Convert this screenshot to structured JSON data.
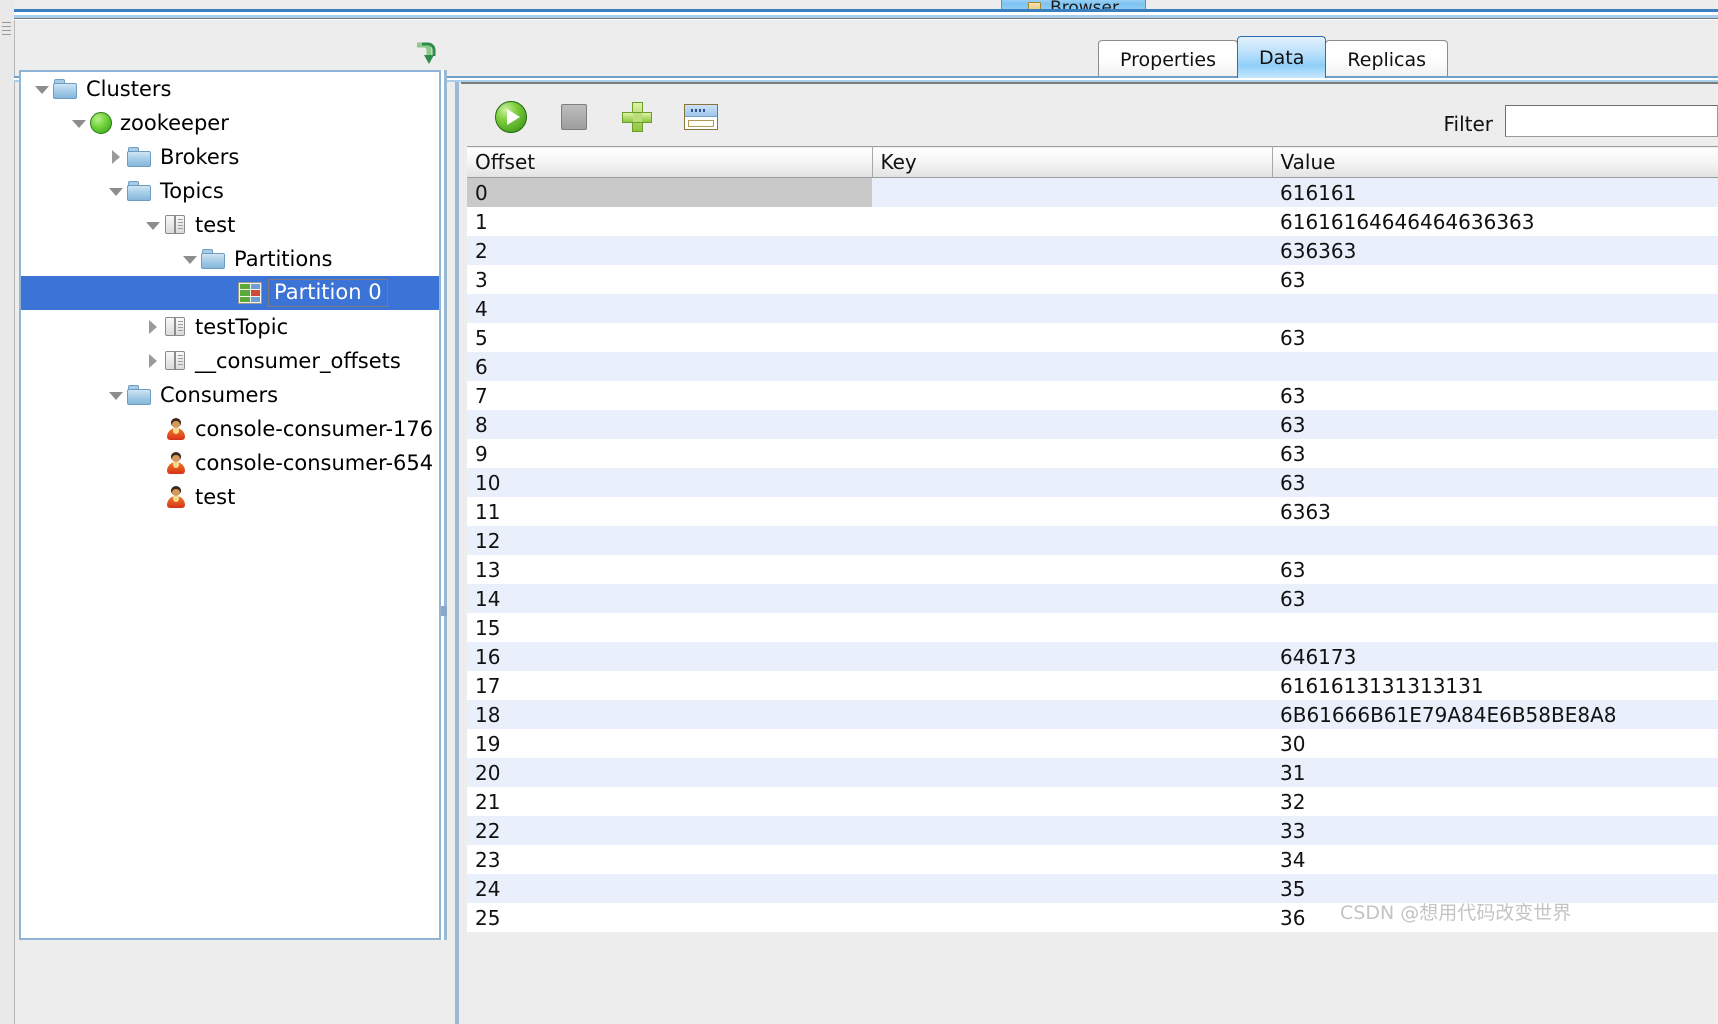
{
  "window": {
    "main_tab": {
      "label": "Browser",
      "icon": "document-icon"
    }
  },
  "panel_tabs": {
    "items": [
      {
        "label": "Properties",
        "active": false
      },
      {
        "label": "Data",
        "active": true
      },
      {
        "label": "Replicas",
        "active": false
      }
    ]
  },
  "tree": {
    "refresh_icon": "refresh-down-arrow-icon",
    "nodes": [
      {
        "label": "Clusters",
        "icon": "folder-icon",
        "twisty": "down",
        "depth": 0,
        "selected": false
      },
      {
        "label": "zookeeper",
        "icon": "green-ball-icon",
        "twisty": "down",
        "depth": 1,
        "selected": false
      },
      {
        "label": "Brokers",
        "icon": "folder-icon",
        "twisty": "right",
        "depth": 2,
        "selected": false
      },
      {
        "label": "Topics",
        "icon": "folder-icon",
        "twisty": "down",
        "depth": 2,
        "selected": false
      },
      {
        "label": "test",
        "icon": "book-icon",
        "twisty": "down",
        "depth": 3,
        "selected": false
      },
      {
        "label": "Partitions",
        "icon": "folder-icon",
        "twisty": "down",
        "depth": 4,
        "selected": false
      },
      {
        "label": "Partition 0",
        "icon": "partition-icon",
        "twisty": "none",
        "depth": 5,
        "selected": true
      },
      {
        "label": "testTopic",
        "icon": "book-icon",
        "twisty": "right",
        "depth": 3,
        "selected": false
      },
      {
        "label": "__consumer_offsets",
        "icon": "book-icon",
        "twisty": "right",
        "depth": 3,
        "selected": false
      },
      {
        "label": "Consumers",
        "icon": "folder-icon",
        "twisty": "down",
        "depth": 2,
        "selected": false
      },
      {
        "label": "console-consumer-176",
        "icon": "user-icon",
        "twisty": "none",
        "depth": 3,
        "selected": false
      },
      {
        "label": "console-consumer-654",
        "icon": "user-icon",
        "twisty": "none",
        "depth": 3,
        "selected": false
      },
      {
        "label": "test",
        "icon": "user-icon",
        "twisty": "none",
        "depth": 3,
        "selected": false
      }
    ]
  },
  "toolbar": {
    "play_icon": "play-icon",
    "stop_icon": "stop-icon",
    "add_icon": "plus-icon",
    "form_icon": "form-window-icon",
    "filter_label": "Filter",
    "filter_value": "",
    "filter_placeholder": ""
  },
  "table": {
    "columns": [
      "Offset",
      "Key",
      "Value"
    ],
    "rows": [
      {
        "offset": "0",
        "key": "",
        "value": "616161"
      },
      {
        "offset": "1",
        "key": "",
        "value": "61616164646464636363"
      },
      {
        "offset": "2",
        "key": "",
        "value": "636363"
      },
      {
        "offset": "3",
        "key": "",
        "value": "63"
      },
      {
        "offset": "4",
        "key": "",
        "value": ""
      },
      {
        "offset": "5",
        "key": "",
        "value": "63"
      },
      {
        "offset": "6",
        "key": "",
        "value": ""
      },
      {
        "offset": "7",
        "key": "",
        "value": "63"
      },
      {
        "offset": "8",
        "key": "",
        "value": "63"
      },
      {
        "offset": "9",
        "key": "",
        "value": "63"
      },
      {
        "offset": "10",
        "key": "",
        "value": "63"
      },
      {
        "offset": "11",
        "key": "",
        "value": "6363"
      },
      {
        "offset": "12",
        "key": "",
        "value": ""
      },
      {
        "offset": "13",
        "key": "",
        "value": "63"
      },
      {
        "offset": "14",
        "key": "",
        "value": "63"
      },
      {
        "offset": "15",
        "key": "",
        "value": ""
      },
      {
        "offset": "16",
        "key": "",
        "value": "646173"
      },
      {
        "offset": "17",
        "key": "",
        "value": "6161613131313131"
      },
      {
        "offset": "18",
        "key": "",
        "value": "6B61666B61E79A84E6B58BE8A8"
      },
      {
        "offset": "19",
        "key": "",
        "value": "30"
      },
      {
        "offset": "20",
        "key": "",
        "value": "31"
      },
      {
        "offset": "21",
        "key": "",
        "value": "32"
      },
      {
        "offset": "22",
        "key": "",
        "value": "33"
      },
      {
        "offset": "23",
        "key": "",
        "value": "34"
      },
      {
        "offset": "24",
        "key": "",
        "value": "35"
      },
      {
        "offset": "25",
        "key": "",
        "value": "36"
      }
    ],
    "selected_row_index": 0
  },
  "watermark": {
    "text": "CSDN @想用代码改变世界"
  },
  "colors": {
    "selection_blue": "#3b73d6",
    "row_stripe": "#eaf0fb",
    "active_tab_blue": "#8fcff8",
    "panel_border": "#8fb4d6"
  }
}
